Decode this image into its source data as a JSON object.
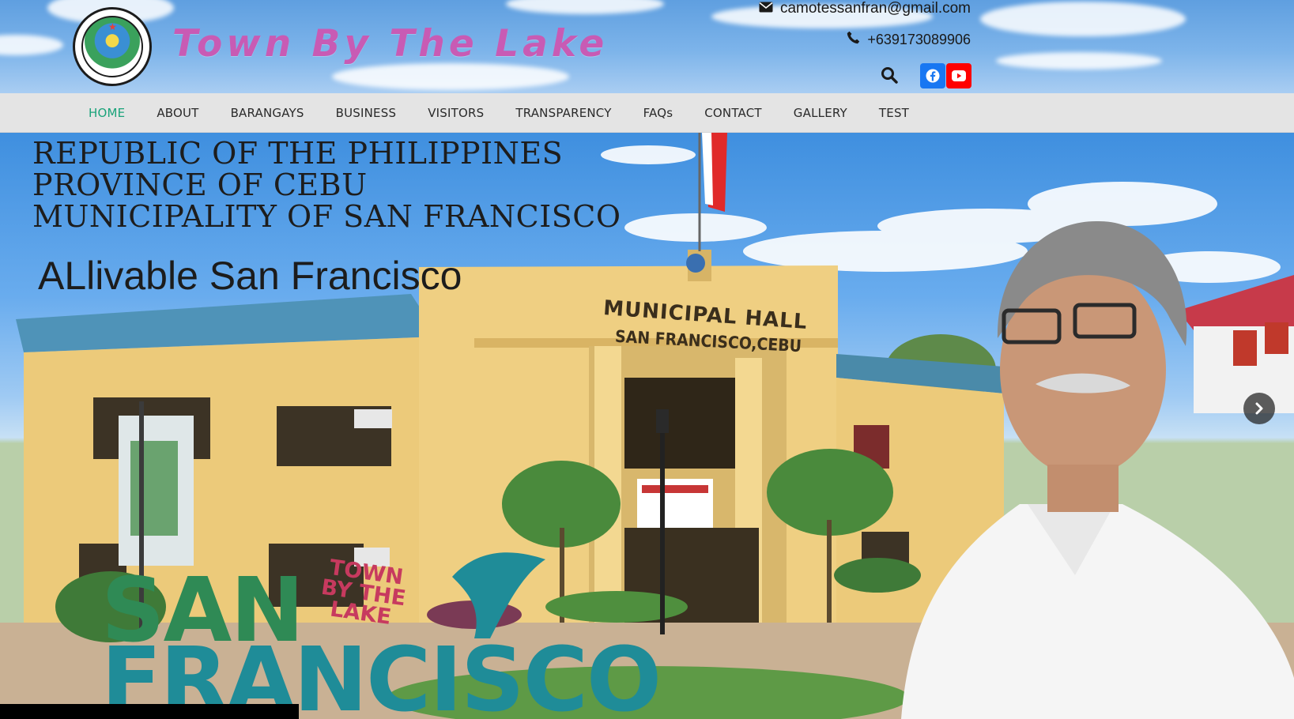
{
  "header": {
    "logo_alt": "Municipality of San Francisco Province of Cebu seal",
    "site_title": "Town By The Lake",
    "email": "camotessanfran@gmail.com",
    "phone": "+639173089906",
    "search_icon": "search-icon",
    "social": [
      {
        "name": "facebook-icon",
        "color": "#1877f2"
      },
      {
        "name": "youtube-icon",
        "color": "#ff0000"
      }
    ]
  },
  "nav": {
    "items": [
      {
        "label": "HOME",
        "active": true
      },
      {
        "label": "ABOUT",
        "active": false
      },
      {
        "label": "BARANGAYS",
        "active": false
      },
      {
        "label": "BUSINESS",
        "active": false
      },
      {
        "label": "VISITORS",
        "active": false
      },
      {
        "label": "TRANSPARENCY",
        "active": false
      },
      {
        "label": "FAQs",
        "active": false
      },
      {
        "label": "CONTACT",
        "active": false
      },
      {
        "label": "GALLERY",
        "active": false
      },
      {
        "label": "TEST",
        "active": false
      }
    ],
    "active_color": "#1aa37a"
  },
  "hero": {
    "banner_lines": [
      "REPUBLIC OF THE PHILIPPINES",
      "PROVINCE OF CEBU",
      "MUNICIPALITY OF SAN FRANCISCO"
    ],
    "tagline": "ALlivable San Francisco",
    "hall_sign_line1": "MUNICIPAL HALL",
    "hall_sign_line2": "SAN FRANCISCO,CEBU",
    "sign_word1": "SAN",
    "sign_word2": "FRANCISCO",
    "sign_small": [
      "TOWN",
      "BY THE",
      "LAKE"
    ],
    "next_icon": "chevron-right-icon"
  }
}
